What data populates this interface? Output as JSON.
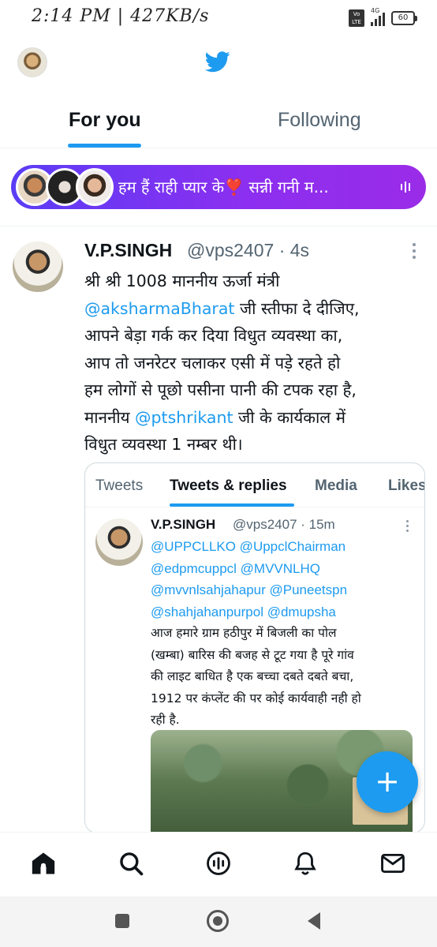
{
  "status_bar": {
    "time": "2:14 PM | 427KB/s",
    "network": "4G",
    "volte": "Vo LTE",
    "battery": "60"
  },
  "header": {
    "logo_icon": "twitter-bird-icon",
    "avatar": "profile-avatar"
  },
  "tabs": [
    {
      "label": "For you",
      "active": true
    },
    {
      "label": "Following",
      "active": false
    }
  ],
  "spaces_bar": {
    "title": "हम हैं राही प्यार के❣️ सन्नी गनी म..."
  },
  "tweet": {
    "name": "V.P.SINGH",
    "meta": "@vps2407 · 4s",
    "text": {
      "l1": "श्री श्री 1008 माननीय ऊर्जा मंत्री",
      "l2_mention": "@aksharmaBharat",
      "l2_rest": " जी स्तीफा दे दीजिए,",
      "l3": "आपने बेड़ा गर्क कर दिया विधुत व्यवस्था का,",
      "l4": "आप तो जनरेटर चलाकर एसी में पड़े रहते हो",
      "l5": "हम लोगों से पूछो पसीना पानी की टपक रहा है,",
      "l6_pre": "माननीय ",
      "l6_mention": "@ptshrikant",
      "l6_rest": " जी के कार्यकाल में",
      "l7": "विधुत व्यवस्था 1 नम्बर थी।"
    }
  },
  "embed": {
    "tabs": [
      {
        "label": "Tweets",
        "active": false
      },
      {
        "label": "Tweets & replies",
        "active": true
      },
      {
        "label": "Media",
        "active": false
      },
      {
        "label": "Likes",
        "active": false
      }
    ],
    "inner_tweet": {
      "name": "V.P.SINGH",
      "meta": "@vps2407 · 15m",
      "mentions": [
        "@UPPCLLKO @UppclChairman",
        "@edpmcuppcl @MVVNLHQ",
        "@mvvnlsahjahapur @Puneetspn",
        "@shahjahanpurpol @dmupsha"
      ],
      "text": [
        "आज हमारे ग्राम हठीपुर में बिजली का पोल",
        "(खम्बा) बारिस की बजह से टूट गया है पूरे गांव",
        "की लाइट बाधित है एक बच्चा दबते दबते बचा,",
        "1912 पर कंप्लेंट की पर कोई कार्यवाही नही हो",
        "रही है."
      ]
    }
  },
  "fab": {
    "label": "+"
  },
  "bottom_nav": [
    {
      "icon": "home-icon",
      "active": true
    },
    {
      "icon": "search-icon",
      "active": false
    },
    {
      "icon": "spaces-icon",
      "active": false
    },
    {
      "icon": "notifications-icon",
      "active": false
    },
    {
      "icon": "messages-icon",
      "active": false
    }
  ],
  "colors": {
    "accent": "#1d9bf0",
    "text_primary": "#0f1419",
    "text_secondary": "#536471",
    "spaces_gradient_start": "#5b3df5",
    "spaces_gradient_end": "#9a2ce8"
  }
}
